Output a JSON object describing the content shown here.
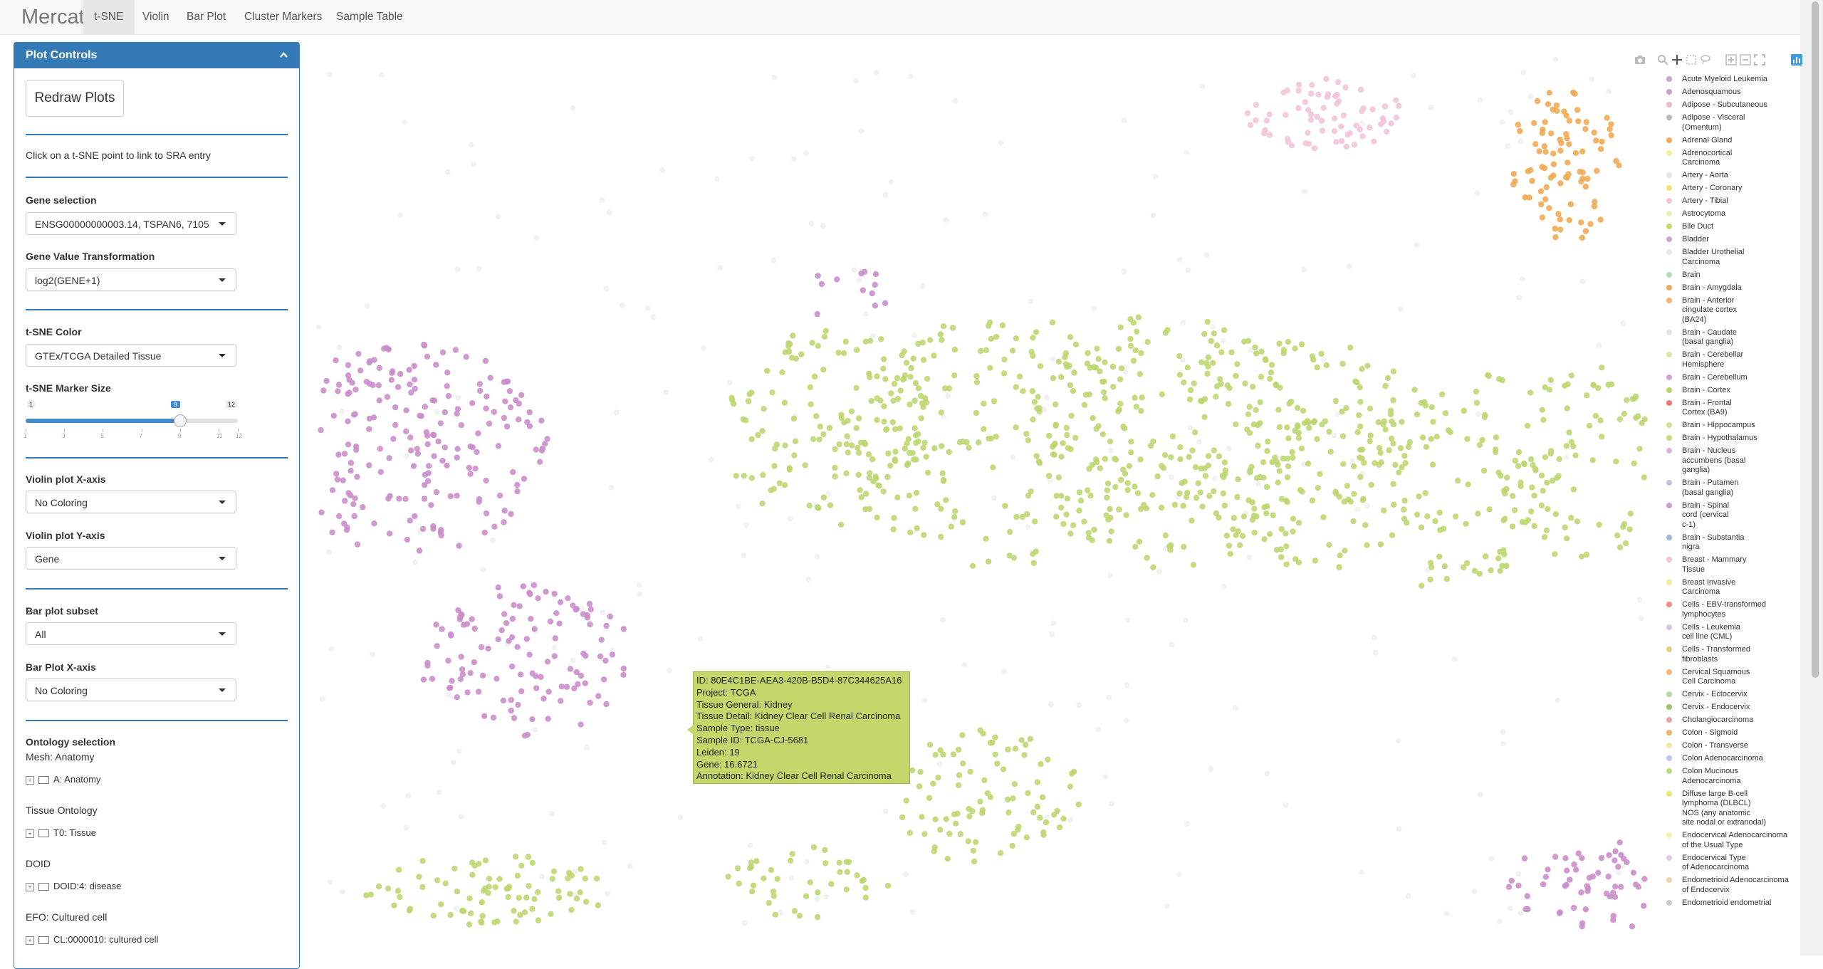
{
  "nav": {
    "brand": "Mercator",
    "tabs": [
      "t-SNE",
      "Violin",
      "Bar Plot",
      "Cluster Markers",
      "Sample Table"
    ],
    "active_tab": "t-SNE"
  },
  "panel": {
    "title": "Plot Controls",
    "redraw_label": "Redraw Plots",
    "help_text": "Click on a t-SNE point to link to SRA entry",
    "gene_selection_label": "Gene selection",
    "gene_selection_value": "ENSG00000000003.14, TSPAN6, 7105",
    "transform_label": "Gene Value Transformation",
    "transform_value": "log2(GENE+1)",
    "tsne_color_label": "t-SNE Color",
    "tsne_color_value": "GTEx/TCGA Detailed Tissue",
    "marker_size_label": "t-SNE Marker Size",
    "slider": {
      "min": "1",
      "max": "12",
      "value": 9,
      "value_label": "9",
      "ticks": [
        "1",
        "3",
        "5",
        "7",
        "9",
        "11",
        "12"
      ]
    },
    "violin_x_label": "Violin plot X-axis",
    "violin_x_value": "No Coloring",
    "violin_y_label": "Violin plot Y-axis",
    "violin_y_value": "Gene",
    "bar_subset_label": "Bar plot subset",
    "bar_subset_value": "All",
    "bar_x_label": "Bar Plot X-axis",
    "bar_x_value": "No Coloring",
    "ontology_label": "Ontology selection",
    "mesh_label": "Mesh: Anatomy",
    "mesh_node": "A: Anatomy",
    "tissue_ont_label": "Tissue Ontology",
    "tissue_ont_node": "T0: Tissue",
    "doid_label": "DOID",
    "doid_node": "DOID:4: disease",
    "efo_label": "EFO: Cultured cell",
    "efo_node": "CL:0000010: cultured cell"
  },
  "tooltip": {
    "id": "ID:  80E4C1BE-AEA3-420B-B5D4-87C344625A16",
    "project": "Project:  TCGA",
    "tissue_general": "Tissue General:  Kidney",
    "tissue_detail": "Tissue Detail:  Kidney Clear Cell Renal Carcinoma",
    "sample_type": "Sample Type:  tissue",
    "sample_id": "Sample ID:  TCGA-CJ-5681",
    "leiden": "Leiden:   19",
    "gene": "Gene:  16.6721",
    "annotation": "Annotation:  Kidney Clear Cell Renal Carcinoma"
  },
  "legend": [
    {
      "label": "Acute Myeloid Leukemia",
      "color": "#c7a6c9"
    },
    {
      "label": "Adenosquamous",
      "color": "#c9a0c4"
    },
    {
      "label": "Adipose - Subcutaneous",
      "color": "#f3b6cc"
    },
    {
      "label": "Adipose - Visceral (Omentum)",
      "color": "#b7b7b7"
    },
    {
      "label": "Adrenal Gland",
      "color": "#f0a95c"
    },
    {
      "label": "Adrenocortical Carcinoma",
      "color": "#f4f0a0"
    },
    {
      "label": "Artery - Aorta",
      "color": "#e3e3e3"
    },
    {
      "label": "Artery - Coronary",
      "color": "#f6e27a"
    },
    {
      "label": "Artery - Tibial",
      "color": "#f2c6cf"
    },
    {
      "label": "Astrocytoma",
      "color": "#e6f0b8"
    },
    {
      "label": "Bile Duct",
      "color": "#c6dc6a"
    },
    {
      "label": "Bladder",
      "color": "#c9a9c9"
    },
    {
      "label": "Bladder Urothelial Carcinoma",
      "color": "#e7e7e7"
    },
    {
      "label": "Brain",
      "color": "#b7e0b7"
    },
    {
      "label": "Brain - Amygdala",
      "color": "#f2a85e"
    },
    {
      "label": "Brain - Anterior cingulate cortex (BA24)",
      "color": "#f6b07a"
    },
    {
      "label": "Brain - Caudate (basal ganglia)",
      "color": "#e4e4e4"
    },
    {
      "label": "Brain - Cerebellar Hemisphere",
      "color": "#d9e8a8"
    },
    {
      "label": "Brain - Cerebellum",
      "color": "#d7a3d7"
    },
    {
      "label": "Brain - Cortex",
      "color": "#b9d56a"
    },
    {
      "label": "Brain - Frontal Cortex (BA9)",
      "color": "#ef7a7a"
    },
    {
      "label": "Brain - Hippocampus",
      "color": "#cfe29a"
    },
    {
      "label": "Brain - Hypothalamus",
      "color": "#c5da7e"
    },
    {
      "label": "Brain - Nucleus accumbens (basal ganglia)",
      "color": "#dbb3db"
    },
    {
      "label": "Brain - Putamen (basal ganglia)",
      "color": "#c0c0e0"
    },
    {
      "label": "Brain - Spinal cord (cervical c-1)",
      "color": "#c9a0c9"
    },
    {
      "label": "Brain - Substantia nigra",
      "color": "#9fb6d6"
    },
    {
      "label": "Breast - Mammary Tissue",
      "color": "#f4c4d4"
    },
    {
      "label": "Breast Invasive Carcinoma",
      "color": "#f4ec9a"
    },
    {
      "label": "Cells - EBV-transformed lymphocytes",
      "color": "#ef8e7e"
    },
    {
      "label": "Cells - Leukemia cell line (CML)",
      "color": "#d7c3e3"
    },
    {
      "label": "Cells - Transformed fibroblasts",
      "color": "#ecd27a"
    },
    {
      "label": "Cervical Squamous Cell Carcinoma",
      "color": "#f2b47a"
    },
    {
      "label": "Cervix - Ectocervix",
      "color": "#b7d7a7"
    },
    {
      "label": "Cervix - Endocervix",
      "color": "#9dc56a"
    },
    {
      "label": "Cholangiocarcinoma",
      "color": "#e7a3a3"
    },
    {
      "label": "Colon - Sigmoid",
      "color": "#f0b070"
    },
    {
      "label": "Colon - Transverse",
      "color": "#f4e6a6"
    },
    {
      "label": "Colon Adenocarcinoma",
      "color": "#b9c9e9"
    },
    {
      "label": "Colon Mucinous Adenocarcinoma",
      "color": "#b9d97a"
    },
    {
      "label": "Diffuse large B-cell lymphoma (DLBCL) NOS (any anatomic site nodal or extranodal)",
      "color": "#e9e97a"
    },
    {
      "label": "Endocervical Adenocarcinoma of the Usual Type",
      "color": "#f4f0b0"
    },
    {
      "label": "Endocervical Type of Adenocarcinoma",
      "color": "#e3c9e3"
    },
    {
      "label": "Endometrioid Adenocarcinoma of Endocervix",
      "color": "#e7d3b0"
    },
    {
      "label": "Endometrioid endometrial",
      "color": "#c9c9c9"
    }
  ],
  "legend_display": [
    [
      "Acute Myeloid Leukemia"
    ],
    [
      "Adenosquamous"
    ],
    [
      "Adipose - Subcutaneous"
    ],
    [
      "Adipose - Visceral",
      "(Omentum)"
    ],
    [
      "Adrenal Gland"
    ],
    [
      "Adrenocortical",
      "Carcinoma"
    ],
    [
      "Artery - Aorta"
    ],
    [
      "Artery - Coronary"
    ],
    [
      "Artery - Tibial"
    ],
    [
      "Astrocytoma"
    ],
    [
      "Bile Duct"
    ],
    [
      "Bladder"
    ],
    [
      "Bladder Urothelial",
      "Carcinoma"
    ],
    [
      "Brain"
    ],
    [
      "Brain - Amygdala"
    ],
    [
      "Brain - Anterior",
      "cingulate cortex",
      "(BA24)"
    ],
    [
      "Brain - Caudate",
      "(basal ganglia)"
    ],
    [
      "Brain - Cerebellar",
      "Hemisphere"
    ],
    [
      "Brain - Cerebellum"
    ],
    [
      "Brain - Cortex"
    ],
    [
      "Brain - Frontal",
      "Cortex (BA9)"
    ],
    [
      "Brain - Hippocampus"
    ],
    [
      "Brain - Hypothalamus"
    ],
    [
      "Brain - Nucleus",
      "accumbens (basal",
      "ganglia)"
    ],
    [
      "Brain - Putamen",
      "(basal ganglia)"
    ],
    [
      "Brain - Spinal",
      "cord (cervical",
      "c-1)"
    ],
    [
      "Brain - Substantia",
      "nigra"
    ],
    [
      "Breast - Mammary",
      "Tissue"
    ],
    [
      "Breast Invasive",
      "Carcinoma"
    ],
    [
      "Cells - EBV-transformed",
      "lymphocytes"
    ],
    [
      "Cells - Leukemia",
      "cell line (CML)"
    ],
    [
      "Cells - Transformed",
      "fibroblasts"
    ],
    [
      "Cervical Squamous",
      "Cell Carcinoma"
    ],
    [
      "Cervix - Ectocervix"
    ],
    [
      "Cervix - Endocervix"
    ],
    [
      "Cholangiocarcinoma"
    ],
    [
      "Colon - Sigmoid"
    ],
    [
      "Colon - Transverse"
    ],
    [
      "Colon Adenocarcinoma"
    ],
    [
      "Colon Mucinous",
      "Adenocarcinoma"
    ],
    [
      "Diffuse large B-cell",
      "lymphoma (DLBCL)",
      "NOS (any anatomic",
      "site nodal or extranodal)"
    ],
    [
      "Endocervical Adenocarcinoma",
      "of the Usual Type"
    ],
    [
      "Endocervical Type",
      "of Adenocarcinoma"
    ],
    [
      "Endometrioid Adenocarcinoma",
      "of Endocervix"
    ],
    [
      "Endometrioid endometrial"
    ]
  ],
  "toolbar_icons": [
    "camera-icon",
    "zoom-icon",
    "pan-icon",
    "box-select-icon",
    "lasso-select-icon",
    "zoom-in-icon",
    "zoom-out-icon",
    "autoscale-icon",
    "plotly-logo-icon"
  ],
  "colors": {
    "primary": "#337ab7",
    "purple": "#c98ccb",
    "green": "#bcd66e",
    "orange": "#f0a852",
    "pink": "#f2c4d8"
  }
}
